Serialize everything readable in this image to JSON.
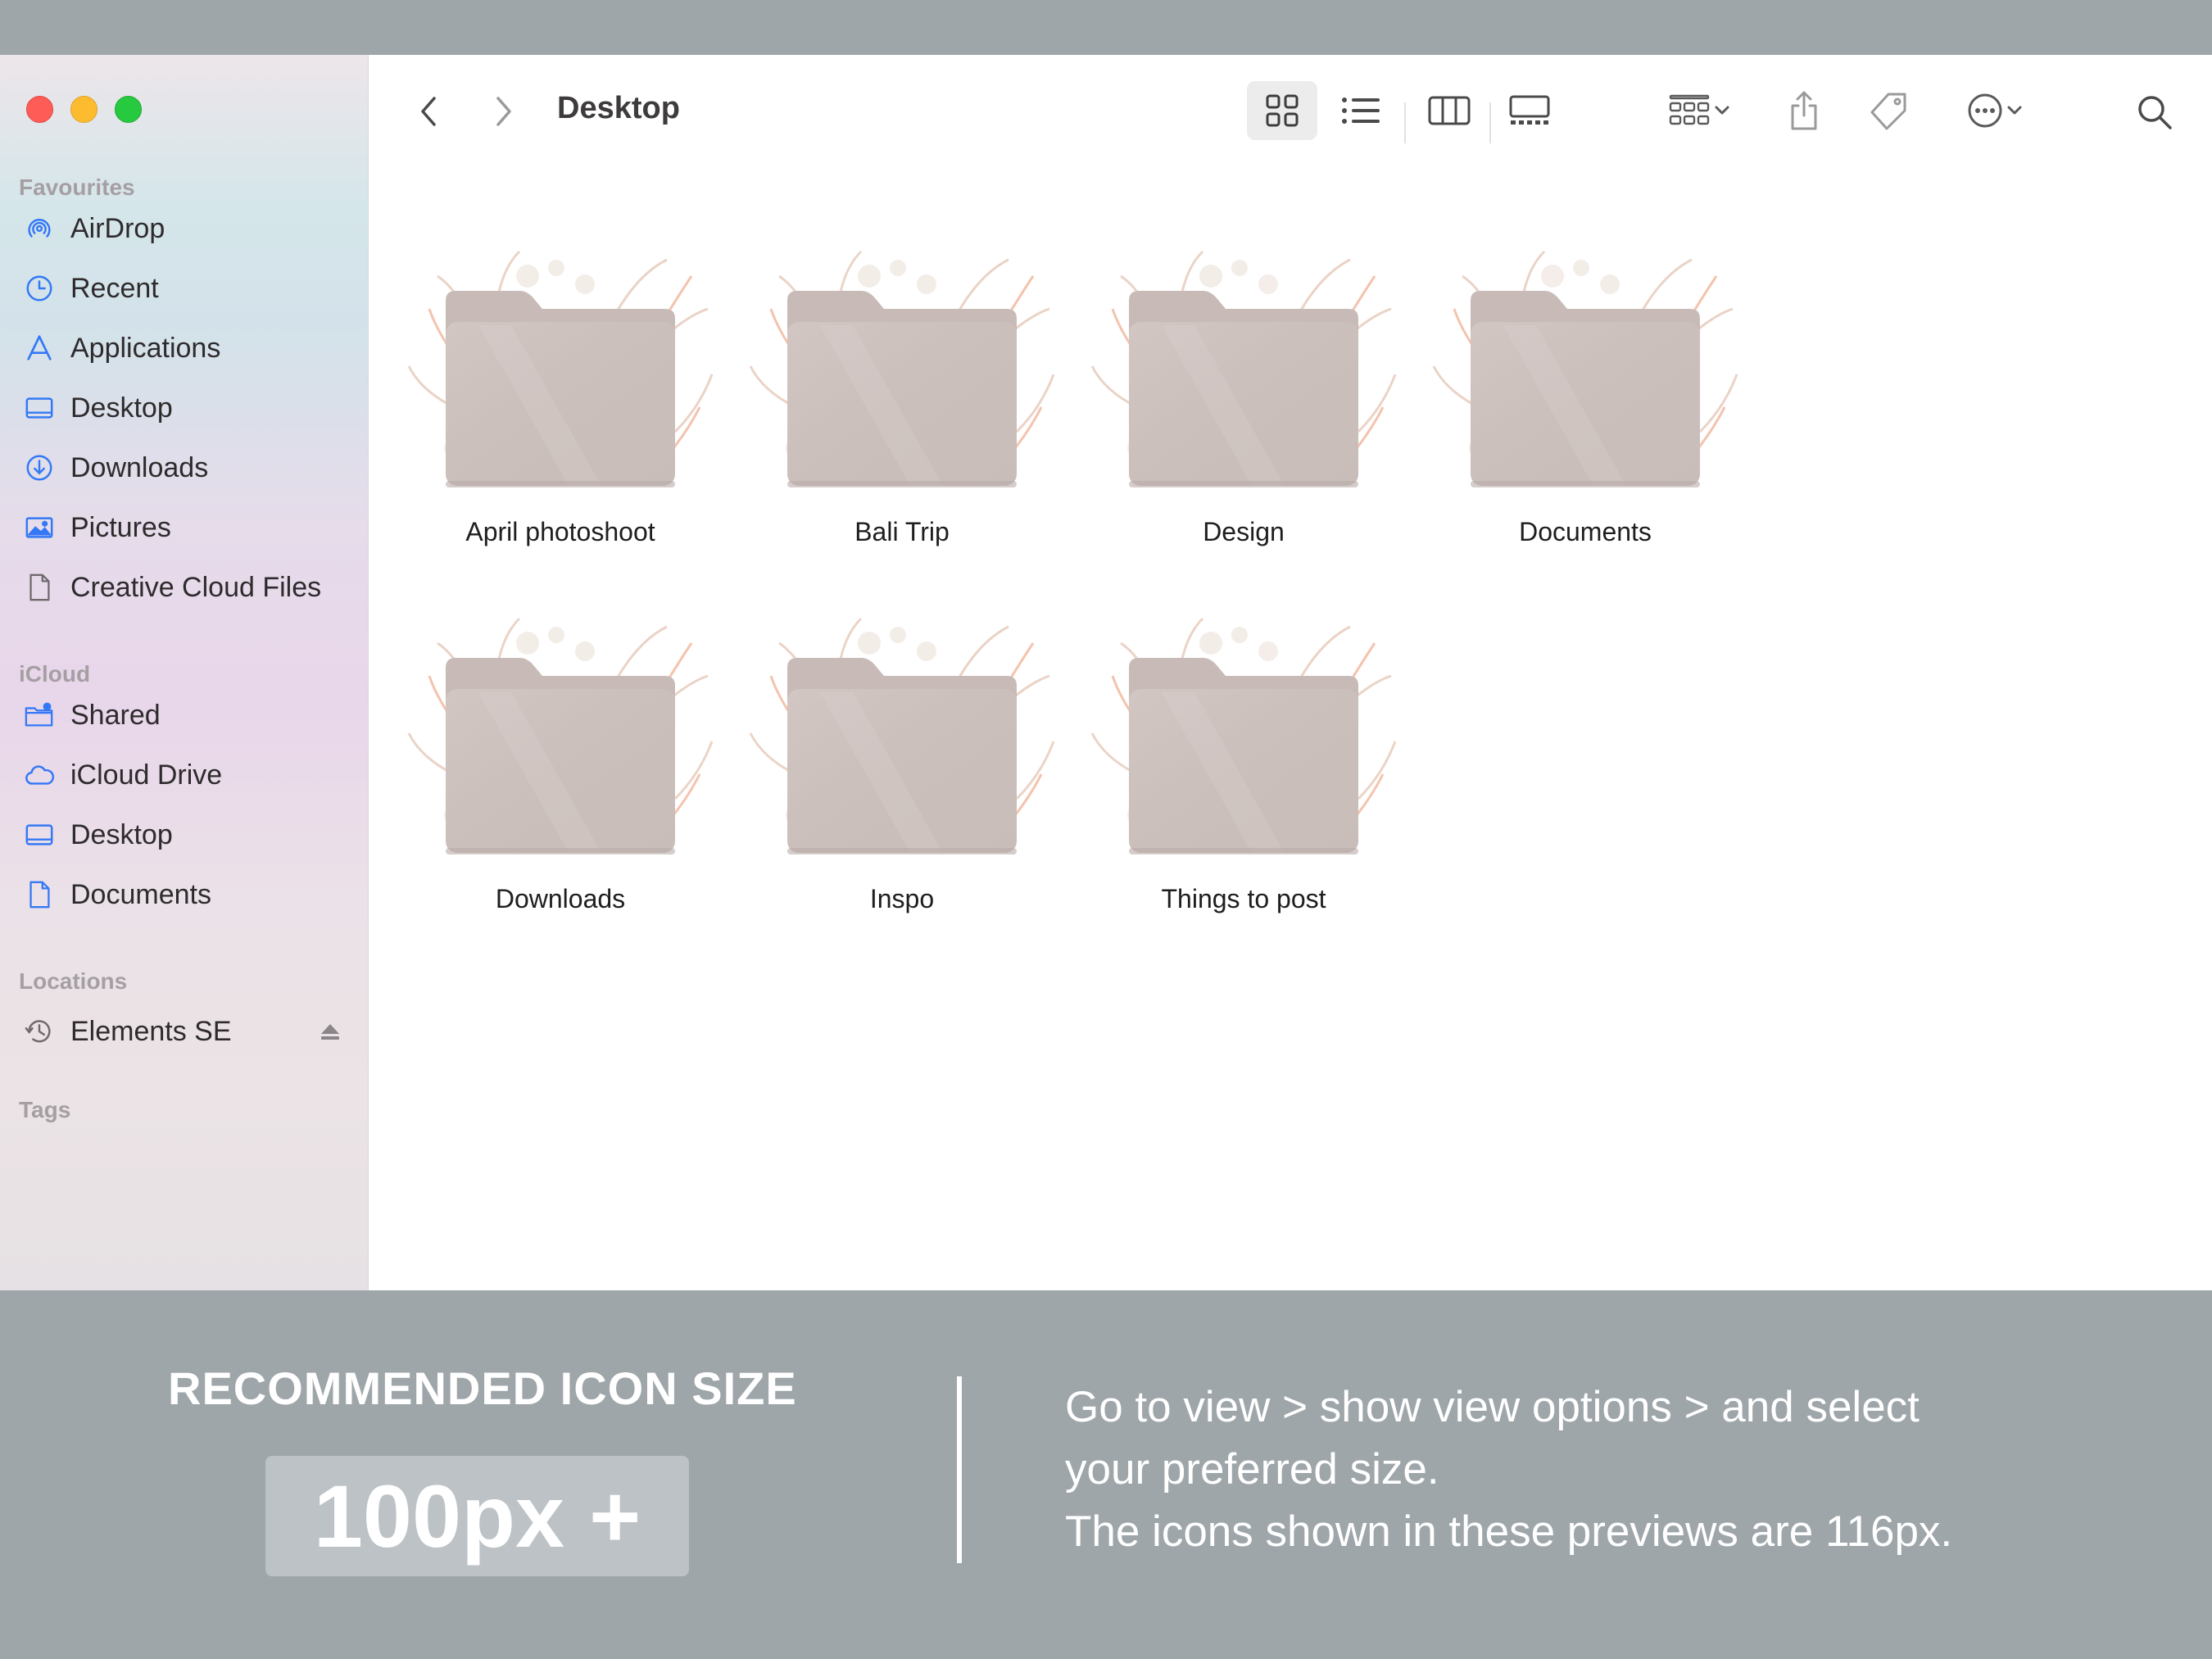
{
  "sidebar": {
    "sections": {
      "favourites": "Favourites",
      "icloud": "iCloud",
      "locations": "Locations",
      "tags": "Tags"
    },
    "favourites": [
      {
        "label": "AirDrop",
        "icon": "airdrop-icon"
      },
      {
        "label": "Recent",
        "icon": "clock-icon"
      },
      {
        "label": "Applications",
        "icon": "applications-icon"
      },
      {
        "label": "Desktop",
        "icon": "desktop-icon"
      },
      {
        "label": "Downloads",
        "icon": "download-icon"
      },
      {
        "label": "Pictures",
        "icon": "pictures-icon"
      },
      {
        "label": "Creative Cloud Files",
        "icon": "document-icon"
      }
    ],
    "icloud": [
      {
        "label": "Shared",
        "icon": "shared-folder-icon"
      },
      {
        "label": "iCloud Drive",
        "icon": "cloud-icon"
      },
      {
        "label": "Desktop",
        "icon": "desktop-icon"
      },
      {
        "label": "Documents",
        "icon": "document-icon"
      }
    ],
    "locations": [
      {
        "label": "Elements SE",
        "icon": "time-machine-icon"
      }
    ]
  },
  "toolbar": {
    "title": "Desktop"
  },
  "folders": [
    {
      "name": "April photoshoot"
    },
    {
      "name": "Bali Trip"
    },
    {
      "name": "Design"
    },
    {
      "name": "Documents"
    },
    {
      "name": "Downloads"
    },
    {
      "name": "Inspo"
    },
    {
      "name": "Things to post"
    }
  ],
  "info": {
    "title": "RECOMMENDED ICON SIZE",
    "size": "100px +",
    "line1": "Go to view > show view options > and select",
    "line2": "your preferred size.",
    "line3": "The icons shown in these previews are 116px."
  },
  "colors": {
    "accent": "#3478f6",
    "folder": "#cfc3bf",
    "banner": "#9ea6aa"
  }
}
